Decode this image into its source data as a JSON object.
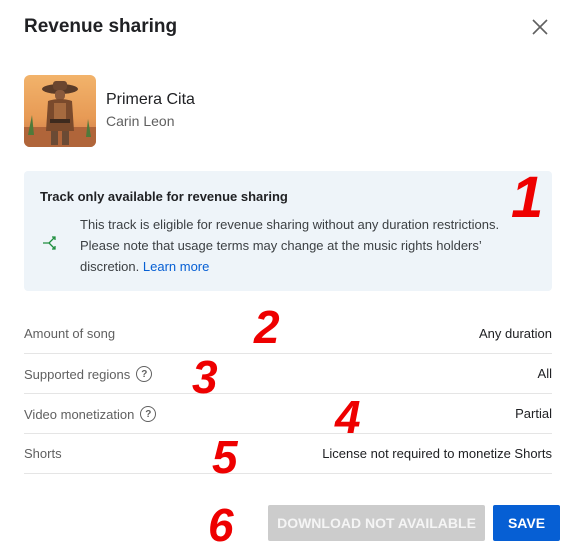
{
  "dialog": {
    "title": "Revenue sharing",
    "close_icon": "close-icon"
  },
  "track": {
    "title": "Primera Cita",
    "artist": "Carin Leon"
  },
  "info_box": {
    "heading": "Track only available for revenue sharing",
    "body": "This track is eligible for revenue sharing without any duration restrictions. Please note that usage terms may change at the music rights holders’ discretion.",
    "link": "Learn more",
    "icon": "branch-icon",
    "icon_color": "#1e8e3e",
    "background": "#eef4f9"
  },
  "rows": [
    {
      "label": "Amount of song",
      "value": "Any duration",
      "help": false
    },
    {
      "label": "Supported regions",
      "value": "All",
      "help": true
    },
    {
      "label": "Video monetization",
      "value": "Partial",
      "help": true
    },
    {
      "label": "Shorts",
      "value": "License not required to monetize Shorts",
      "help": false
    }
  ],
  "help_glyph": "?",
  "buttons": {
    "download": "DOWNLOAD NOT AVAILABLE",
    "save": "SAVE",
    "save_color": "#065fd4"
  },
  "markers": {
    "m1": "1",
    "m2": "2",
    "m3": "3",
    "m4": "4",
    "m5": "5",
    "m6": "6",
    "color": "#ee0000"
  }
}
